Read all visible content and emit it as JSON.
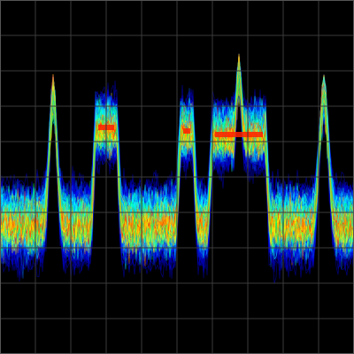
{
  "chart_data": {
    "type": "heatmap",
    "subtype": "persistence-spectrum",
    "title": "",
    "xlabel": "",
    "ylabel": "",
    "grid": true,
    "grid_divisions": {
      "x": 10,
      "y": 10
    },
    "colormap": [
      "#000000",
      "#0000cc",
      "#0000ff",
      "#0066ff",
      "#00ffff",
      "#00ff66",
      "#ffff00",
      "#ff8800",
      "#ff0000"
    ],
    "noise_floor": {
      "level": 0.63,
      "spread": 0.14
    },
    "signals": [
      {
        "name": "",
        "kind": "spur",
        "center": 0.15,
        "width": 0.01,
        "peak": 0.21,
        "floor_level": 0.63
      },
      {
        "name": "",
        "kind": "carrier",
        "start": 0.27,
        "end": 0.33,
        "top": 0.36,
        "dense_band": 0.36
      },
      {
        "name": "",
        "kind": "carrier",
        "start": 0.51,
        "end": 0.545,
        "top": 0.36,
        "dense_band": 0.37
      },
      {
        "name": "",
        "kind": "carrier",
        "start": 0.6,
        "end": 0.75,
        "top": 0.29,
        "dense_band": 0.38
      },
      {
        "name": "",
        "kind": "spur",
        "center": 0.675,
        "width": 0.006,
        "peak": 0.15,
        "floor_level": 0.3
      },
      {
        "name": "",
        "kind": "spur",
        "center": 0.915,
        "width": 0.012,
        "peak": 0.21,
        "floor_level": 0.63
      }
    ]
  }
}
